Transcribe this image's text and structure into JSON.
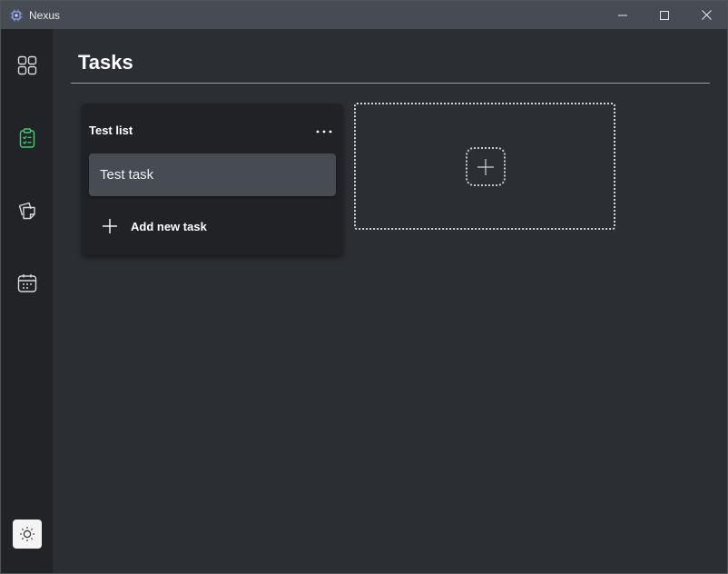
{
  "window": {
    "title": "Nexus",
    "controls": [
      "minimize-icon",
      "maximize-icon",
      "close-icon"
    ]
  },
  "sidebar": {
    "items": [
      {
        "name": "dashboard",
        "icon": "grid-icon",
        "active": false
      },
      {
        "name": "tasks",
        "icon": "clipboard-checklist-icon",
        "active": true
      },
      {
        "name": "notes",
        "icon": "sticky-notes-icon",
        "active": false
      },
      {
        "name": "calendar",
        "icon": "calendar-icon",
        "active": false
      }
    ],
    "theme_toggle_icon": "sun-icon"
  },
  "page": {
    "title": "Tasks"
  },
  "lists": [
    {
      "title": "Test list",
      "tasks": [
        {
          "label": "Test task"
        }
      ],
      "add_task_label": "Add new task"
    }
  ],
  "new_list_icon": "plus-icon",
  "colors": {
    "accent": "#3ecf7a",
    "sidebar_bg": "#212327",
    "main_bg": "#2b2e33",
    "titlebar_bg": "#464c51",
    "card_bg": "#202226",
    "task_bg": "#464c52"
  }
}
